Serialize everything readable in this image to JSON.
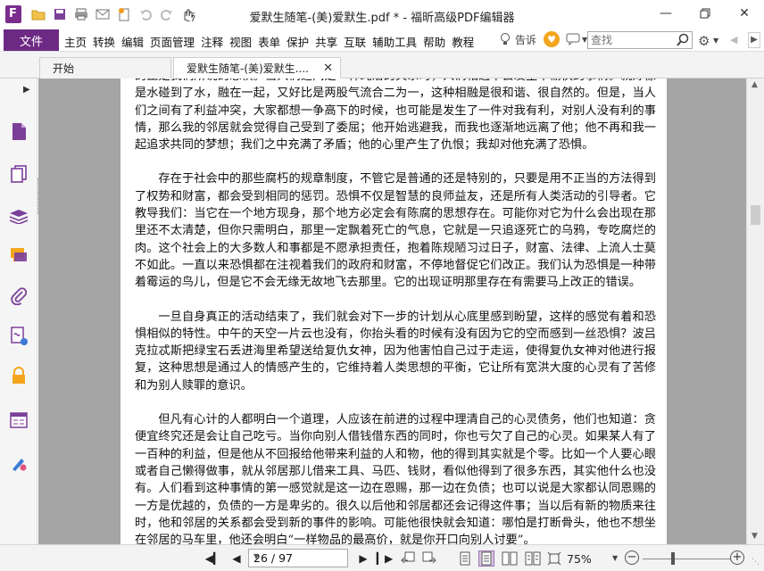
{
  "window": {
    "title": "爱默生随笔-(美)爱默生.pdf * - 福昕高级PDF编辑器"
  },
  "menubar": {
    "file_label": "文件",
    "items": [
      "主页",
      "转换",
      "编辑",
      "页面管理",
      "注释",
      "视图",
      "表单",
      "保护",
      "共享",
      "互联",
      "辅助工具",
      "帮助",
      "教程"
    ],
    "tell_label": "告诉",
    "search_placeholder": "查找"
  },
  "tabs": {
    "start_label": "开始",
    "doc_label": "爱默生随笔-(美)爱默生....",
    "close_glyph": "✕"
  },
  "document": {
    "paragraphs": [
      "的正是我们所说的恐惧。当人们之间是一种纯洁的关系时，人们相遇不会发生不愉快的事情。就好像是水碰到了水，融在一起，又好比是两股气流合二为一，这种相融是很和谐、很自然的。但是，当人们之间有了利益冲突，大家都想一争高下的时候，也可能是发生了一件对我有利，对别人没有利的事情，那么我的邻居就会觉得自己受到了委屈；他开始逃避我，而我也逐渐地远离了他；他不再和我一起追求共同的梦想；我们之中充满了矛盾；他的心里产生了仇恨；我却对他充满了恐惧。",
      "存在于社会中的那些腐朽的规章制度，不管它是普通的还是特别的，只要是用不正当的方法得到了权势和财富，都会受到相同的惩罚。恐惧不仅是智慧的良师益友，还是所有人类活动的引导者。它教导我们：当它在一个地方现身，那个地方必定会有陈腐的思想存在。可能你对它为什么会出现在那里还不太清楚，但你只需明白，那里一定飘着死亡的气息，它就是一只追逐死亡的乌鸦，专吃腐烂的肉。这个社会上的大多数人和事都是不愿承担责任，抱着陈规陋习过日子，财富、法律、上流人士莫不如此。一直以来恐惧都在注视着我们的政府和财富，不停地督促它们改正。我们认为恐惧是一种带着霉运的鸟儿，但是它不会无缘无故地飞去那里。它的出现证明那里存在有需要马上改正的错误。",
      "一旦自身真正的活动结束了，我们就会对下一步的计划从心底里感到盼望，这样的感觉有着和恐惧相似的特性。中午的天空一片云也没有，你抬头看的时候有没有因为它的空而感到一丝恐惧？波吕克拉忒斯把绿宝石丢进海里希望送给复仇女神，因为他害怕自己过于走运，使得复仇女神对他进行报复，这种思想是通过人的情感产生的，它维持着人类思想的平衡，它让所有宽洪大度的心灵有了苦修和为别人赎罪的意识。",
      "但凡有心计的人都明白一个道理，人应该在前进的过程中理清自己的心灵债务，他们也知道：贪便宜终究还是会让自己吃亏。当你向别人借钱借东西的同时，你也亏欠了自己的心灵。如果某人有了一百种的利益，但是他从不回报给他带来利益的人和物，他的得到其实就是个零。比如一个人要心眼或者自己懒得做事，就从邻居那儿借来工具、马匹、钱财，看似他得到了很多东西，其实他什么也没有。人们看到这种事情的第一感觉就是这一边在恩赐，那一边在负债；也可以说是大家都认同恩赐的一方是优越的，负债的一方是卑劣的。很久以后他和邻居都还会记得这件事；当以后有新的物质来往时，他和邻居的关系都会受到新的事件的影响。可能他很快就会知道：哪怕是打断骨头，他也不想坐在邻居的马车里，他还会明白“一样物品的最高价，就是你开口向别人讨要”。"
    ]
  },
  "statusbar": {
    "page_display": "26 / 97",
    "current_page": 26,
    "total_pages": 97,
    "zoom_label": "75%",
    "zoom_percent": 75
  },
  "colors": {
    "brand": "#6d2a84",
    "doc_background": "#a5a5a5"
  }
}
